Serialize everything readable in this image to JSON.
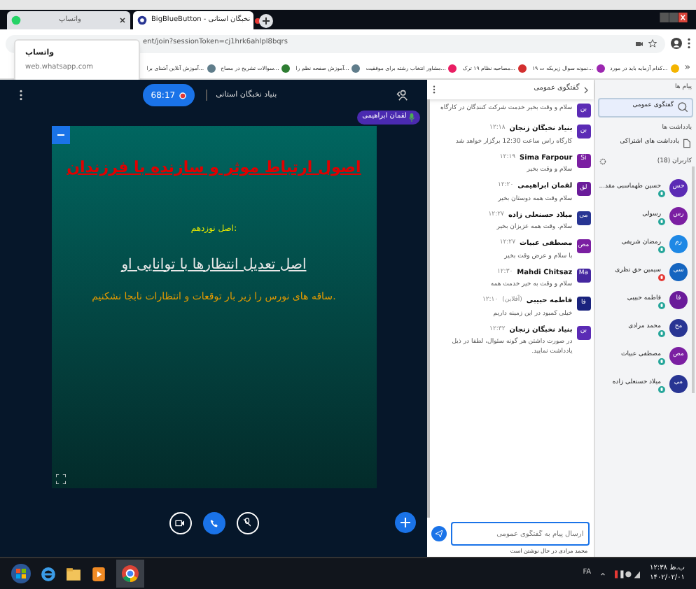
{
  "browser": {
    "tabs": [
      {
        "title": "BigBlueButton - نخبگان استانی",
        "kind": "bbb",
        "selected": true
      },
      {
        "title": "واتساپ",
        "kind": "whatsapp",
        "selected": false
      }
    ],
    "tooltip": {
      "title": "واتساپ",
      "url": "web.whatsapp.com"
    },
    "address": "ent/join?sessionToken=cj1hrk6ahlpl8bqrs",
    "bookmarks_overflow": "»",
    "bookmarks": [
      {
        "title": "کدام آزمایه باید در مورد...",
        "color": "#f4b400"
      },
      {
        "title": "۱۹ نمونه سوال زیربکه ت...",
        "color": "#9c27b0"
      },
      {
        "title": "مصاحبه نظام ۱۹ ترک...",
        "color": "#d32f2f"
      },
      {
        "title": "مشاور انتخاب رشته برای موفقیت...",
        "color": "#e91e63"
      },
      {
        "title": "آموزش صفحه نظم را...",
        "color": "#607d8b"
      },
      {
        "title": "سوالات تشریح در مصاح...",
        "color": "#2e7d32"
      },
      {
        "title": "آموزش آنلاین آشنای برا...",
        "color": "#607d8b"
      }
    ]
  },
  "meeting": {
    "timer": "68:17",
    "recording": true,
    "title": "بنیاد نخبگان استانی",
    "presenter": "لقمان ابراهیمی",
    "slide": {
      "title": "اصول ارتباط موثر و سازنده با فرزندان",
      "subtitle": "اصل نوزدهم:",
      "heading": "اصل تعدیل انتظارها با توانایی او",
      "body": "ساقه های نورس را زیر بار توقعات و انتظارات نابجا نشکنیم."
    }
  },
  "chat": {
    "title": "گفتگوی عمومی",
    "messages": [
      {
        "avatar": "بن",
        "color": "#5b2bb5",
        "text": "سلام و وقت بخیر خدمت شرکت کنندگان در کارگاه"
      },
      {
        "avatar": "بن",
        "color": "#5b2bb5",
        "name": "بنیاد نخبگان زنجان",
        "time": "۱۲:۱۸",
        "text": "کارگاه راس ساعت 12:30 برگزار خواهد شد"
      },
      {
        "avatar": "Si",
        "color": "#7b1fa2",
        "name": "Sima Farpour",
        "time": "۱۲:۱۹",
        "text": "سلام و وقت بخیر"
      },
      {
        "avatar": "لق",
        "color": "#6a1b9a",
        "name": "لقمان ابراهیمی",
        "time": "۱۲:۲۰",
        "text": "سلام وقت همه دوستان بخیر"
      },
      {
        "avatar": "می",
        "color": "#283593",
        "name": "میلاد حسنعلی زاده",
        "time": "۱۲:۲۷",
        "text": "سلام. وقت همه عزیزان بخیر"
      },
      {
        "avatar": "مص",
        "color": "#7b1fa2",
        "name": "مصطفی عبیات",
        "time": "۱۲:۲۷",
        "text": "با سلام و عرض وقت بخیر"
      },
      {
        "avatar": "Ma",
        "color": "#4527a0",
        "name": "Mahdi Chitsaz",
        "time": "۱۲:۳۰",
        "text": "سلام و وقت به خیر خدمت همه"
      },
      {
        "avatar": "فا",
        "color": "#1a237e",
        "name": "فاطمه حبیبی",
        "status": "(آفلاین)",
        "time": "۱۲:۱۰",
        "text": "خیلی کمبود در این زمینه داریم"
      },
      {
        "avatar": "بن",
        "color": "#5b2bb5",
        "name": "بنیاد نخبگان زنجان",
        "time": "۱۲:۳۲",
        "text": "در صورت داشتن هر گونه سئوال، لطفا در ذیل یادداشت نمایید."
      }
    ],
    "placeholder": "ارسال پیام به گفتگوی عمومی",
    "typing": "محمد مرادی در حال نوشتن است"
  },
  "sidebar": {
    "messages_heading": "پیام ها",
    "public_chat": {
      "label": "گفتگوی عمومی",
      "selected": true
    },
    "notes_heading": "یادداشت ها",
    "shared_notes": "یادداشت های اشتراکی",
    "users_heading": "کاربران (18)",
    "users": [
      {
        "avatar": "حس",
        "color": "#5b2bb5",
        "name": "حسین طهماسبی مقد...",
        "muted": false
      },
      {
        "avatar": "رس",
        "color": "#7b1fa2",
        "name": "رسولی",
        "muted": false
      },
      {
        "avatar": "رم",
        "color": "#1e88e5",
        "name": "رمضان شریفی",
        "muted": false
      },
      {
        "avatar": "سی",
        "color": "#1565c0",
        "name": "سیمین حق نظری",
        "muted": true
      },
      {
        "avatar": "فا",
        "color": "#6a1b9a",
        "name": "فاطمه حبیبی",
        "muted": false
      },
      {
        "avatar": "مح",
        "color": "#283593",
        "name": "محمد مرادی",
        "muted": false
      },
      {
        "avatar": "مص",
        "color": "#7b1fa2",
        "name": "مصطفی عبیات",
        "muted": false
      },
      {
        "avatar": "می",
        "color": "#283593",
        "name": "میلاد حسنعلی زاده",
        "muted": false
      }
    ]
  },
  "taskbar": {
    "language": "FA",
    "time": "۱۲:۳۸ ب.ظ",
    "date": "۱۴۰۲/۰۲/۰۱"
  }
}
